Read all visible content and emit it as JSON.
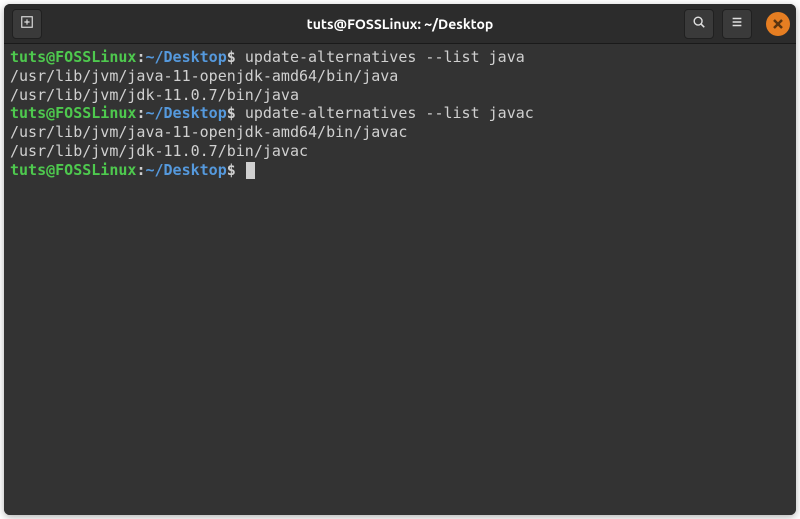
{
  "titlebar": {
    "title": "tuts@FOSSLinux: ~/Desktop",
    "new_tab_icon": "new-tab-icon",
    "search_icon": "search-icon",
    "menu_icon": "hamburger-icon",
    "close_icon": "close-icon"
  },
  "prompt": {
    "user_host": "tuts@FOSSLinux",
    "separator": ":",
    "path": "~/Desktop",
    "symbol": "$"
  },
  "lines": [
    {
      "type": "cmd",
      "command": "update-alternatives --list java"
    },
    {
      "type": "out",
      "text": "/usr/lib/jvm/java-11-openjdk-amd64/bin/java"
    },
    {
      "type": "out",
      "text": "/usr/lib/jvm/jdk-11.0.7/bin/java"
    },
    {
      "type": "cmd",
      "command": "update-alternatives --list javac"
    },
    {
      "type": "out",
      "text": "/usr/lib/jvm/java-11-openjdk-amd64/bin/javac"
    },
    {
      "type": "out",
      "text": "/usr/lib/jvm/jdk-11.0.7/bin/javac"
    },
    {
      "type": "cmd",
      "command": "",
      "cursor": true
    }
  ],
  "colors": {
    "bg": "#333333",
    "titlebar": "#2c2c2c",
    "text": "#d0d0d0",
    "prompt_user": "#4ec94e",
    "prompt_path": "#5599dd",
    "close": "#e67e22"
  }
}
